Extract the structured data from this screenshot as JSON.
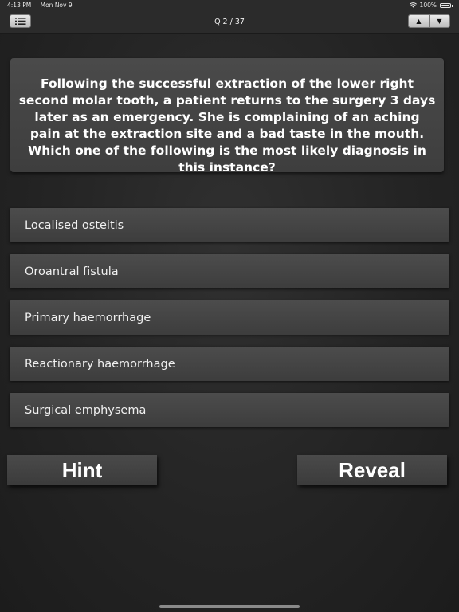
{
  "status_bar": {
    "time": "4:13 PM",
    "date": "Mon Nov 9",
    "battery": "100%"
  },
  "nav": {
    "title": "Q 2 / 37",
    "up_icon": "▲",
    "down_icon": "▼",
    "menu_icon": "list-icon"
  },
  "question": {
    "text": "Following the successful extraction of the lower right second molar tooth, a patient returns to the surgery 3 days later as an emergency. She is complaining of an aching pain at the extraction site and a bad taste in the mouth. Which one of the following is the most likely diagnosis in this instance?"
  },
  "answers": [
    {
      "label": "Localised osteitis"
    },
    {
      "label": "Oroantral fistula"
    },
    {
      "label": "Primary haemorrhage"
    },
    {
      "label": "Reactionary haemorrhage"
    },
    {
      "label": "Surgical emphysema"
    }
  ],
  "actions": {
    "hint_label": "Hint",
    "reveal_label": "Reveal"
  }
}
